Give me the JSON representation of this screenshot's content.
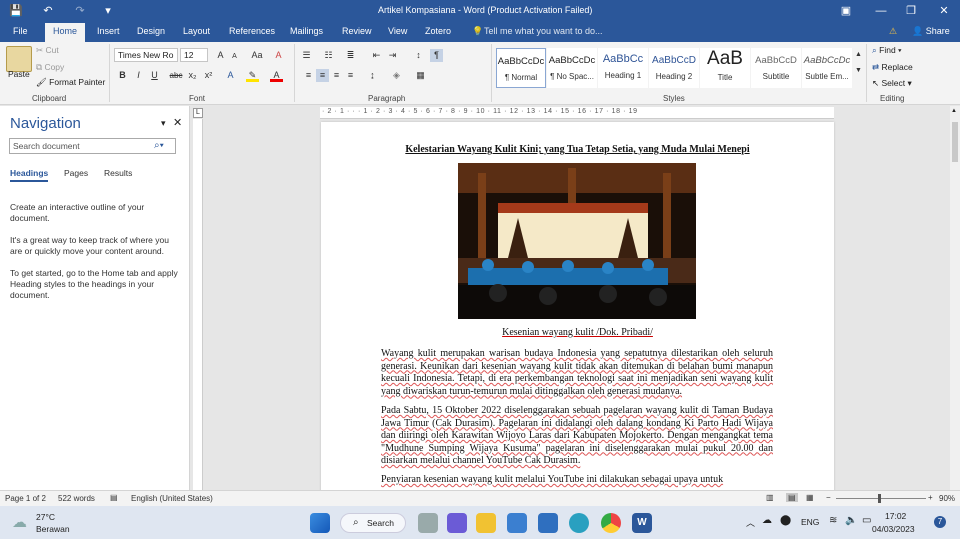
{
  "titlebar": {
    "title": "Artikel Kompasiana - Word (Product Activation Failed)",
    "save_icon": "💾",
    "undo_icon": "↶",
    "redo_icon": "↷",
    "more_icon": "▾",
    "ribbon_opts_icon": "▣",
    "minimize": "—",
    "restore": "❐",
    "close": "✕"
  },
  "tabs": {
    "items": [
      "File",
      "Home",
      "Insert",
      "Design",
      "Layout",
      "References",
      "Mailings",
      "Review",
      "View",
      "Zotero"
    ],
    "tell_me": "Tell me what you want to do...",
    "share": "Share"
  },
  "clipboard": {
    "paste": "Paste",
    "cut": "Cut",
    "copy": "Copy",
    "format_painter": "Format Painter",
    "label": "Clipboard"
  },
  "font": {
    "name": "Times New Ro",
    "size": "12",
    "label": "Font",
    "bold": "B",
    "italic": "I",
    "underline": "U",
    "strike": "abc",
    "sub": "x₂",
    "sup": "x²",
    "grow": "A^",
    "shrink": "Aˇ",
    "case": "Aa",
    "clear": "A"
  },
  "paragraph": {
    "label": "Paragraph"
  },
  "styles": {
    "label": "Styles",
    "items": [
      {
        "preview": "AaBbCcDc",
        "name": "¶ Normal"
      },
      {
        "preview": "AaBbCcDc",
        "name": "¶ No Spac..."
      },
      {
        "preview": "AaBbCc",
        "name": "Heading 1"
      },
      {
        "preview": "AaBbCcD",
        "name": "Heading 2"
      },
      {
        "preview": "AaB",
        "name": "Title"
      },
      {
        "preview": "AaBbCcD",
        "name": "Subtitle"
      },
      {
        "preview": "AaBbCcDc",
        "name": "Subtle Em..."
      }
    ]
  },
  "editing": {
    "label": "Editing",
    "find": "Find",
    "replace": "Replace",
    "select": "Select"
  },
  "nav": {
    "title": "Navigation",
    "search_placeholder": "Search document",
    "tabs": [
      "Headings",
      "Pages",
      "Results"
    ],
    "msg1": "Create an interactive outline of your document.",
    "msg2": "It's a great way to keep track of where you are or quickly move your content around.",
    "msg3": "To get started, go to the Home tab and apply Heading styles to the headings in your document."
  },
  "ruler": "· 2 · 1 · · · 1 · 2 · 3 · 4 · 5 · 6 · 7 · 8 · 9 · 10 · 11 · 12 · 13 · 14 · 15 · 16 · 17 · 18 · 19",
  "document": {
    "heading": "Kelestarian Wayang Kulit Kini; yang Tua Tetap Setia, yang Muda Mulai Menepi",
    "caption": "Kesenian wayang kulit /Dok. Pribadi/",
    "p1": "Wayang kulit merupakan warisan budaya Indonesia yang sepatutnya dilestarikan oleh seluruh generasi. Keunikan dari kesenian wayang kulit tidak akan ditemukan di belahan bumi manapun kecuali Indonesia. Tetapi, di era perkembangan teknologi saat ini menjadikan seni wayang kulit yang diwariskan turun-temurun mulai ditinggalkan oleh generasi mudanya.",
    "p2": "Pada Sabtu, 15 Oktober 2022 diselenggarakan sebuah pagelaran wayang kulit di Taman Budaya Jawa Timur (Cak Durasim). Pagelaran ini didalangi oleh dalang kondang Ki Parto Hadi Wijaya dan diiringi oleh Karawitan Wijoyo Laras dari Kabupaten Mojokerto. Dengan mengangkat tema \"Mudhune Sumping Wijaya Kusuma\" pagelaran ini diselenggarakan mulai pukul 20.00 dan disiarkan melalui channel YouTube Cak Durasim.",
    "p3": "Penyiaran kesenian wayang kulit melalui YouTube ini dilakukan sebagai upaya untuk"
  },
  "status": {
    "page": "Page 1 of 2",
    "words": "522 words",
    "lang": "English (United States)",
    "zoom": "90%"
  },
  "taskbar": {
    "temp": "27°C",
    "weather": "Berawan",
    "search": "Search",
    "lang": "ENG",
    "time": "17:02",
    "date": "04/03/2023",
    "badge": "7"
  },
  "colors": {
    "accent": "#2b579a"
  }
}
